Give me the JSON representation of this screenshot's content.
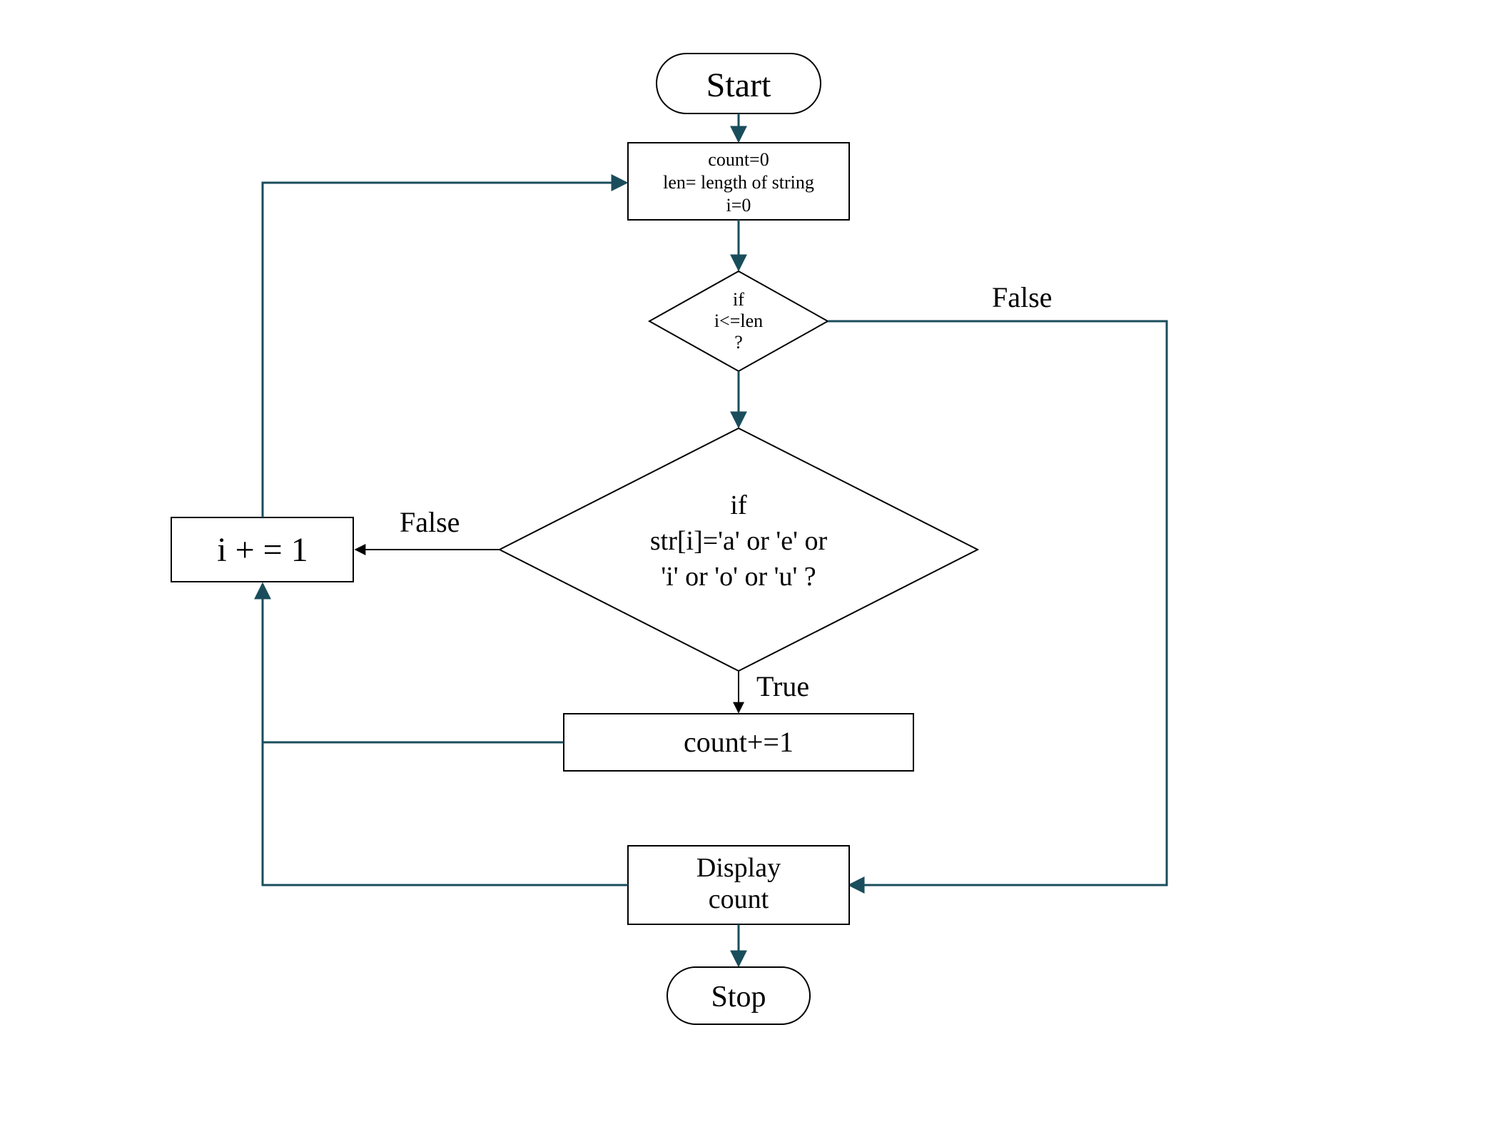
{
  "nodes": {
    "start": "Start",
    "init": {
      "line1": "count=0",
      "line2": "len= length of string",
      "line3": "i=0"
    },
    "cond1": {
      "line1": "if",
      "line2": "i<=len",
      "line3": "?"
    },
    "cond2": {
      "line1": "if",
      "line2": "str[i]='a' or 'e' or",
      "line3": "'i' or 'o' or 'u' ?"
    },
    "incCount": "count+=1",
    "incI": "i + = 1",
    "display": {
      "line1": "Display",
      "line2": "count"
    },
    "stop": "Stop"
  },
  "edges": {
    "cond1False": "False",
    "cond2False": "False",
    "cond2True": "True"
  }
}
